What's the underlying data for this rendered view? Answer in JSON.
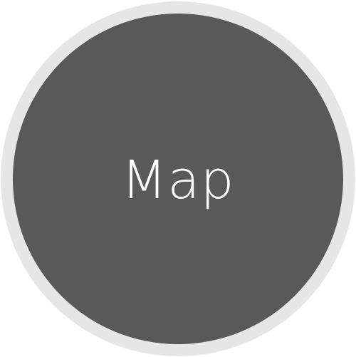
{
  "button": {
    "label": "Map"
  },
  "colors": {
    "disc": "#58595b",
    "ring": "#e6e6e6",
    "label": "#ffffff",
    "background": "#ffffff"
  }
}
